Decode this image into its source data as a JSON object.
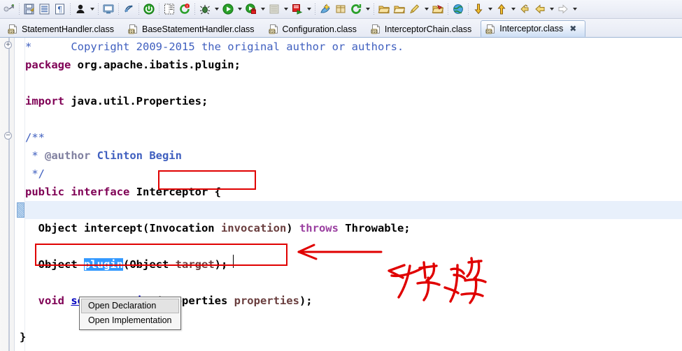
{
  "toolbar": {
    "items": [
      {
        "name": "new-wizard-icon",
        "kind": "icon",
        "glyph": "new"
      },
      {
        "name": "toolbar-separator",
        "kind": "sep"
      },
      {
        "name": "save-icon",
        "kind": "icon",
        "glyph": "save"
      },
      {
        "name": "save-all-icon",
        "kind": "icon",
        "glyph": "saveall"
      },
      {
        "name": "print-icon",
        "kind": "icon",
        "glyph": "print"
      },
      {
        "name": "toolbar-separator",
        "kind": "sep"
      },
      {
        "name": "user-icon",
        "kind": "icon",
        "glyph": "user"
      },
      {
        "name": "user-dropdown-arrow",
        "kind": "arrow"
      },
      {
        "name": "toolbar-separator",
        "kind": "sep"
      },
      {
        "name": "console-icon",
        "kind": "icon",
        "glyph": "console"
      },
      {
        "name": "toolbar-separator",
        "kind": "sep"
      },
      {
        "name": "skip-breakpoints-icon",
        "kind": "icon",
        "glyph": "skipbp"
      },
      {
        "name": "toolbar-separator",
        "kind": "sep"
      },
      {
        "name": "terminate-icon",
        "kind": "icon",
        "glyph": "power"
      },
      {
        "name": "toolbar-separator",
        "kind": "sep"
      },
      {
        "name": "open-type-icon",
        "kind": "icon",
        "glyph": "opentype"
      },
      {
        "name": "refresh-error-icon",
        "kind": "icon",
        "glyph": "refresherr"
      },
      {
        "name": "toolbar-separator",
        "kind": "sep"
      },
      {
        "name": "debug-icon",
        "kind": "icon",
        "glyph": "debug"
      },
      {
        "name": "debug-dropdown-arrow",
        "kind": "arrow"
      },
      {
        "name": "run-icon",
        "kind": "icon",
        "glyph": "run"
      },
      {
        "name": "run-dropdown-arrow",
        "kind": "arrow"
      },
      {
        "name": "run-secure-icon",
        "kind": "icon",
        "glyph": "runsecure"
      },
      {
        "name": "run-secure-dropdown-arrow",
        "kind": "arrow"
      },
      {
        "name": "coverage-icon",
        "kind": "icon",
        "glyph": "coverage"
      },
      {
        "name": "coverage-dropdown-arrow",
        "kind": "arrow"
      },
      {
        "name": "external-tools-icon",
        "kind": "icon",
        "glyph": "exttools"
      },
      {
        "name": "external-tools-dropdown-arrow",
        "kind": "arrow"
      },
      {
        "name": "toolbar-separator",
        "kind": "sep"
      },
      {
        "name": "new-java-class-icon",
        "kind": "icon",
        "glyph": "javaclass"
      },
      {
        "name": "new-package-icon",
        "kind": "icon",
        "glyph": "package"
      },
      {
        "name": "refresh-icon",
        "kind": "icon",
        "glyph": "refresh"
      },
      {
        "name": "refresh-dropdown-arrow",
        "kind": "arrow"
      },
      {
        "name": "toolbar-separator",
        "kind": "sep"
      },
      {
        "name": "open-folder-icon",
        "kind": "icon",
        "glyph": "folderopen"
      },
      {
        "name": "open-resource-icon",
        "kind": "icon",
        "glyph": "folderres"
      },
      {
        "name": "search-icon",
        "kind": "icon",
        "glyph": "searchpen"
      },
      {
        "name": "search-dropdown-arrow",
        "kind": "arrow"
      },
      {
        "name": "open-task-icon",
        "kind": "icon",
        "glyph": "foldertask"
      },
      {
        "name": "toolbar-separator",
        "kind": "sep"
      },
      {
        "name": "web-browser-icon",
        "kind": "icon",
        "glyph": "globe"
      },
      {
        "name": "toolbar-separator",
        "kind": "sep"
      },
      {
        "name": "next-annotation-icon",
        "kind": "icon",
        "glyph": "arrowdown"
      },
      {
        "name": "next-annotation-dropdown-arrow",
        "kind": "arrow"
      },
      {
        "name": "previous-annotation-icon",
        "kind": "icon",
        "glyph": "arrowup"
      },
      {
        "name": "previous-annotation-dropdown-arrow",
        "kind": "arrow"
      },
      {
        "name": "last-edit-location-icon",
        "kind": "icon",
        "glyph": "lastedit"
      },
      {
        "name": "back-icon",
        "kind": "icon",
        "glyph": "back"
      },
      {
        "name": "back-dropdown-arrow",
        "kind": "arrow"
      },
      {
        "name": "forward-icon",
        "kind": "icon",
        "glyph": "forward"
      },
      {
        "name": "forward-dropdown-arrow",
        "kind": "arrow"
      }
    ]
  },
  "tabs": [
    {
      "label": "StatementHandler.class",
      "active": false,
      "closable": false
    },
    {
      "label": "BaseStatementHandler.class",
      "active": false,
      "closable": false
    },
    {
      "label": "Configuration.class",
      "active": false,
      "closable": false
    },
    {
      "label": "InterceptorChain.class",
      "active": false,
      "closable": false
    },
    {
      "label": "Interceptor.class",
      "active": true,
      "closable": true,
      "close_glyph": "✖"
    }
  ],
  "editor": {
    "filename": "Interceptor.class",
    "lines": {
      "copyright": {
        "star": "*",
        "text": "Copyright 2009-2015 the original author or authors."
      },
      "package": {
        "keyword": "package",
        "value": " org.apache.ibatis.plugin;"
      },
      "import": {
        "keyword": "import",
        "value": " java.util.Properties;"
      },
      "javadoc_open": "/**",
      "javadoc_author": {
        "star": " * ",
        "tag": "@author",
        "value": " Clinton Begin"
      },
      "javadoc_close": " */",
      "interface_decl": {
        "modifier": "public",
        "keyword": " interface",
        "name": "Interceptor",
        "brace": " {"
      },
      "intercept": {
        "ret": "  Object intercept(",
        "type1": "Invocation",
        "param1": " invocation",
        "close": ") ",
        "throws_kw": "throws",
        "exc": " Throwable;"
      },
      "plugin": {
        "ret": "  Object ",
        "method": "plugin",
        "args_open": "(Object ",
        "param": "target",
        "args_close": ");"
      },
      "setproperties": {
        "ret": "  void ",
        "method": "setProperties",
        "args_open": "(Properties ",
        "param": "properties",
        "args_close": ");"
      },
      "close_brace": "}"
    },
    "gutter": {
      "fold_collapsed_glyph": "+",
      "fold_expanded_glyph": "−"
    }
  },
  "context_menu": {
    "items": [
      {
        "label": "Open Declaration",
        "highlighted": true
      },
      {
        "label": "Open Implementation",
        "highlighted": false
      }
    ]
  },
  "annotations": {
    "ink_color": "#e00000",
    "boxes": [
      {
        "name": "interceptor-name-highlight"
      },
      {
        "name": "plugin-method-highlight"
      }
    ],
    "arrow": {
      "name": "red-arrow-pointing-to-plugin"
    },
    "handwriting": {
      "name": "handwritten-chinese-note"
    }
  },
  "colors": {
    "keyword": "#7f0055",
    "comment": "#3f5fbf",
    "javadoc_tag": "#7f7f9f",
    "parameter": "#6a3e3e",
    "hyperlink": "#0000c0",
    "selection_bg": "#3399ff",
    "current_line_bg": "#e8f0fb",
    "annotation_red": "#e00000"
  }
}
